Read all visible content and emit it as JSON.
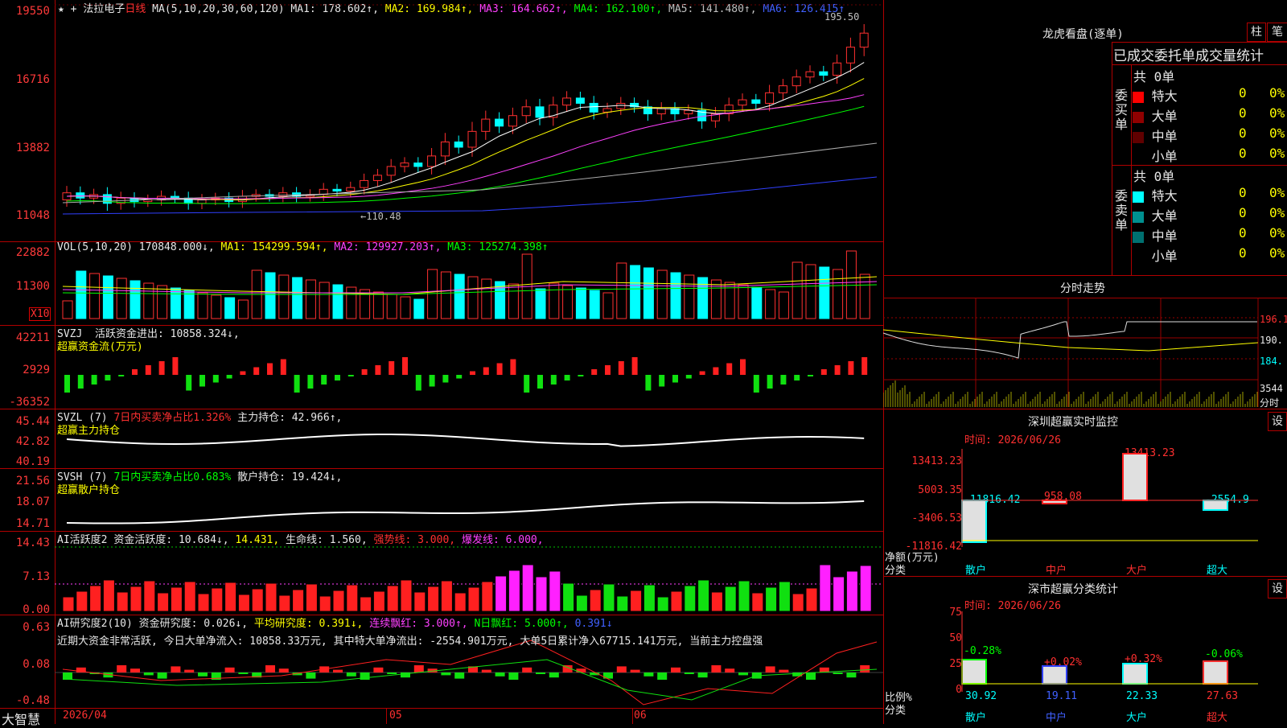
{
  "main_chart": {
    "star": "★",
    "plus_icon": "+",
    "stock_name": "法拉电子",
    "period": "日线",
    "ma_label": "MA(5,10,20,30,60,120)",
    "ma1": "MA1: 178.602↑,",
    "ma2": "MA2: 169.984↑,",
    "ma3": "MA3: 164.662↑,",
    "ma4": "MA4: 162.100↑,",
    "ma5": "MA5: 141.480↑,",
    "ma6": "MA6: 126.415↑",
    "yticks": [
      "19550",
      "16716",
      "13882",
      "11048"
    ],
    "high_label": "195.50",
    "low_label": "←110.48"
  },
  "vol_panel": {
    "label": "VOL(5,10,20)",
    "value": "170848.000↓,",
    "ma1": "MA1: 154299.594↑,",
    "ma2": "MA2: 129927.203↑,",
    "ma3": "MA3: 125274.398↑",
    "yticks": [
      "22882",
      "11300"
    ],
    "unit": "X10"
  },
  "svzj_panel": {
    "label": "SVZJ",
    "text": "活跃资金进出: 10858.324↓,",
    "subtitle": "超赢资金流(万元)",
    "yticks": [
      "42211",
      "2929",
      "-36352"
    ]
  },
  "svzl_panel": {
    "label": "SVZL (7)",
    "red_text": "7日内买卖净占比1.326%",
    "text": "主力持仓: 42.966↑,",
    "subtitle": "超赢主力持仓",
    "yticks": [
      "45.44",
      "42.82",
      "40.19"
    ]
  },
  "svsh_panel": {
    "label": "SVSH (7)",
    "green_text": "7日内买卖净占比0.683%",
    "text": "散户持仓: 19.424↓,",
    "subtitle": "超赢散户持仓",
    "yticks": [
      "21.56",
      "18.07",
      "14.71"
    ]
  },
  "ai_active_panel": {
    "label": "AI活跃度2",
    "text1": "资金活跃度: 10.684↓,",
    "text2": "14.431,",
    "text3": "生命线: 1.560,",
    "text4": "强势线: 3.000,",
    "text5": "爆发线: 6.000,",
    "yticks": [
      "14.43",
      "7.13",
      "0.00"
    ]
  },
  "ai_research_panel": {
    "label": "AI研究度2(10)",
    "text1": "资金研究度: 0.026↓,",
    "text2": "平均研究度: 0.391↓,",
    "text3": "连续飘红: 3.000↑,",
    "text4": "N日飘红: 5.000↑,",
    "text5": "0.391↓",
    "comment": "近期大资金非常活跃, 今日大单净流入: 10858.33万元, 其中特大单净流出: -2554.901万元, 大单5日累计净入67715.141万元, 当前主力控盘强",
    "yticks": [
      "0.63",
      "0.08",
      "-0.48"
    ]
  },
  "x_axis": {
    "brand": "大智慧",
    "date_start": "2026/04",
    "m05": "05",
    "m06": "06"
  },
  "right_panel": {
    "dragon_title": "龙虎看盘(逐单)",
    "btn_bar": "柱",
    "btn_pen": "笔",
    "tabs_text": "已成交委托单成交量统计",
    "buy_total": "共 0单",
    "buy_side": "委买单",
    "sell_total": "共 0单",
    "sell_side": "委卖单",
    "buy_rows": [
      {
        "name": "特大",
        "count": "0",
        "pct": "0%",
        "color": "#ff0000"
      },
      {
        "name": "大单",
        "count": "0",
        "pct": "0%",
        "color": "#900000"
      },
      {
        "name": "中单",
        "count": "0",
        "pct": "0%",
        "color": "#600000"
      },
      {
        "name": "小单",
        "count": "0",
        "pct": "0%",
        "color": "#000000"
      }
    ],
    "sell_rows": [
      {
        "name": "特大",
        "count": "0",
        "pct": "0%",
        "color": "#00ffff"
      },
      {
        "name": "大单",
        "count": "0",
        "pct": "0%",
        "color": "#009090"
      },
      {
        "name": "中单",
        "count": "0",
        "pct": "0%",
        "color": "#007070"
      },
      {
        "name": "小单",
        "count": "0",
        "pct": "0%",
        "color": "#000000"
      }
    ],
    "intraday_title": "分时走势",
    "intraday_yticks": [
      "196.1",
      "190.",
      "184.",
      "3544",
      "分时"
    ],
    "sz_title": "深圳超赢实时监控",
    "sz_btn": "设",
    "sz_time": "时间: 2026/06/26",
    "sz_yticks": [
      "13413.23",
      "5003.35",
      "-3406.53",
      "-11816.42"
    ],
    "sz_ylabel1": "净额(万元)",
    "sz_ylabel2": "分类",
    "sz_values": [
      "-11816.42",
      "958.08",
      "13413.23",
      "-2554.9"
    ],
    "sz_cats": [
      "散户",
      "中户",
      "大户",
      "超大"
    ],
    "sh_title": "深市超赢分类统计",
    "sh_btn": "设",
    "sh_time": "时间: 2026/06/26",
    "sh_yticks": [
      "75",
      "50",
      "25",
      "0"
    ],
    "sh_ylabel1": "比例%",
    "sh_ylabel2": "分类",
    "sh_changes": [
      "-0.28%",
      "+0.02%",
      "+0.32%",
      "-0.06%"
    ],
    "sh_values": [
      "30.92",
      "19.11",
      "22.33",
      "27.63"
    ],
    "sh_cats": [
      "散户",
      "中户",
      "大户",
      "超大"
    ]
  }
}
